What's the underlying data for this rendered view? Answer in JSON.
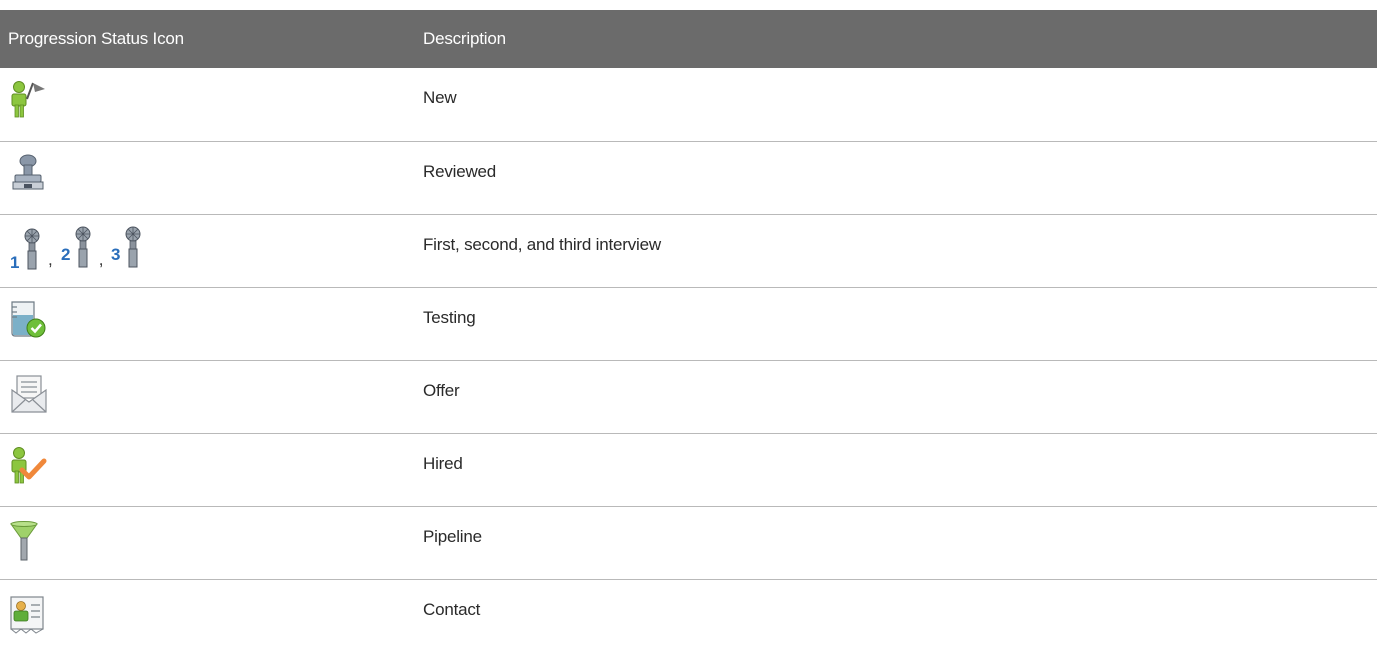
{
  "table": {
    "headers": {
      "icon_col": "Progression Status Icon",
      "description_col": "Description"
    },
    "rows": [
      {
        "icon": "person-flag-icon",
        "description": "New"
      },
      {
        "icon": "stamp-icon",
        "description": "Reviewed"
      },
      {
        "icon": "microphone-icons-1-2-3",
        "description": "First, second, and third interview",
        "separator": ","
      },
      {
        "icon": "beaker-check-icon",
        "description": "Testing"
      },
      {
        "icon": "envelope-letter-icon",
        "description": "Offer"
      },
      {
        "icon": "person-check-icon",
        "description": "Hired"
      },
      {
        "icon": "funnel-icon",
        "description": "Pipeline"
      },
      {
        "icon": "contact-card-icon",
        "description": "Contact"
      }
    ],
    "interview_numbers": [
      "1",
      "2",
      "3"
    ]
  },
  "colors": {
    "header_bg": "#6b6b6b",
    "header_text": "#ffffff",
    "row_divider": "#b9b9b9",
    "icon_green": "#8cc63f",
    "icon_blue": "#2a6ebb",
    "icon_orange": "#f0883a"
  }
}
